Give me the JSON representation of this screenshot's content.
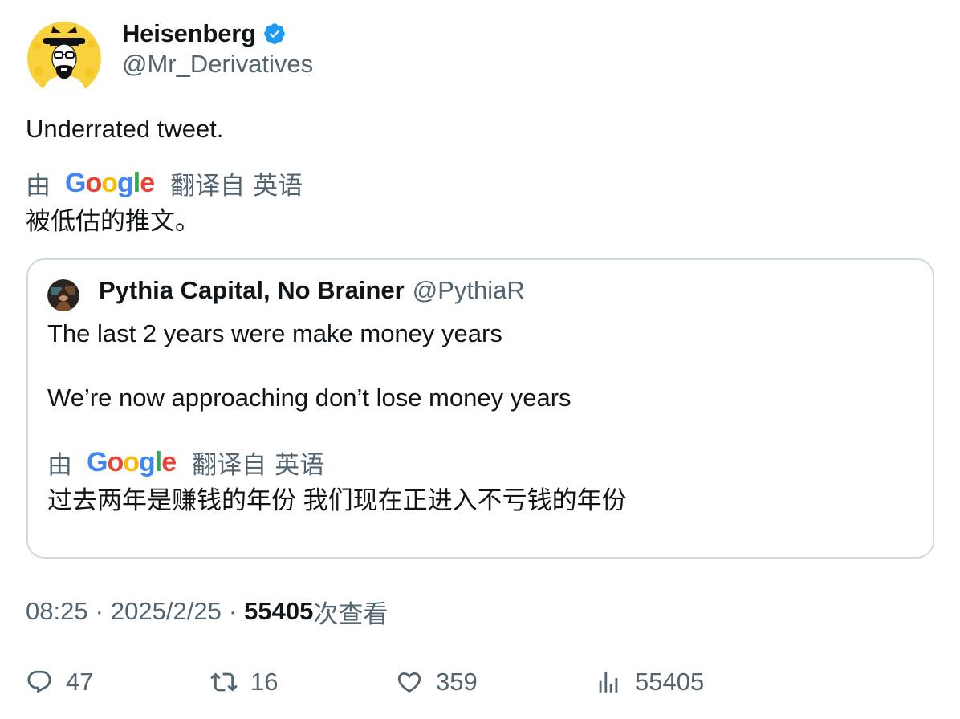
{
  "author": {
    "name": "Heisenberg",
    "handle": "@Mr_Derivatives",
    "verified": true,
    "avatar": "heisenberg-avatar",
    "verified_color": "#1d9bf0"
  },
  "tweet": {
    "text": "Underrated tweet.",
    "translation": {
      "by": "由",
      "provider": "Google",
      "from_label": "翻译自",
      "language": "英语",
      "text": "被低估的推文。"
    }
  },
  "quote": {
    "name": "Pythia Capital, No Brainer",
    "handle": "@PythiaR",
    "avatar": "pythia-avatar",
    "lines": [
      "The last 2 years were make money years",
      "We’re now approaching don’t lose money years"
    ],
    "translation": {
      "by": "由",
      "provider": "Google",
      "from_label": "翻译自",
      "language": "英语",
      "text": "过去两年是赚钱的年份 我们现在正进入不亏钱的年份"
    }
  },
  "meta": {
    "time": "08:25",
    "date": "2025/2/25",
    "separator": "·",
    "views": "55405",
    "views_label": "次查看"
  },
  "actions": {
    "replies": "47",
    "reposts": "16",
    "likes": "359",
    "views": "55405"
  },
  "colors": {
    "text_primary": "#0f1419",
    "text_secondary": "#536471",
    "border": "#cfd9de",
    "google_blue": "#4285f4",
    "google_red": "#ea4335",
    "google_yellow": "#fbbc05",
    "google_green": "#34a853"
  }
}
